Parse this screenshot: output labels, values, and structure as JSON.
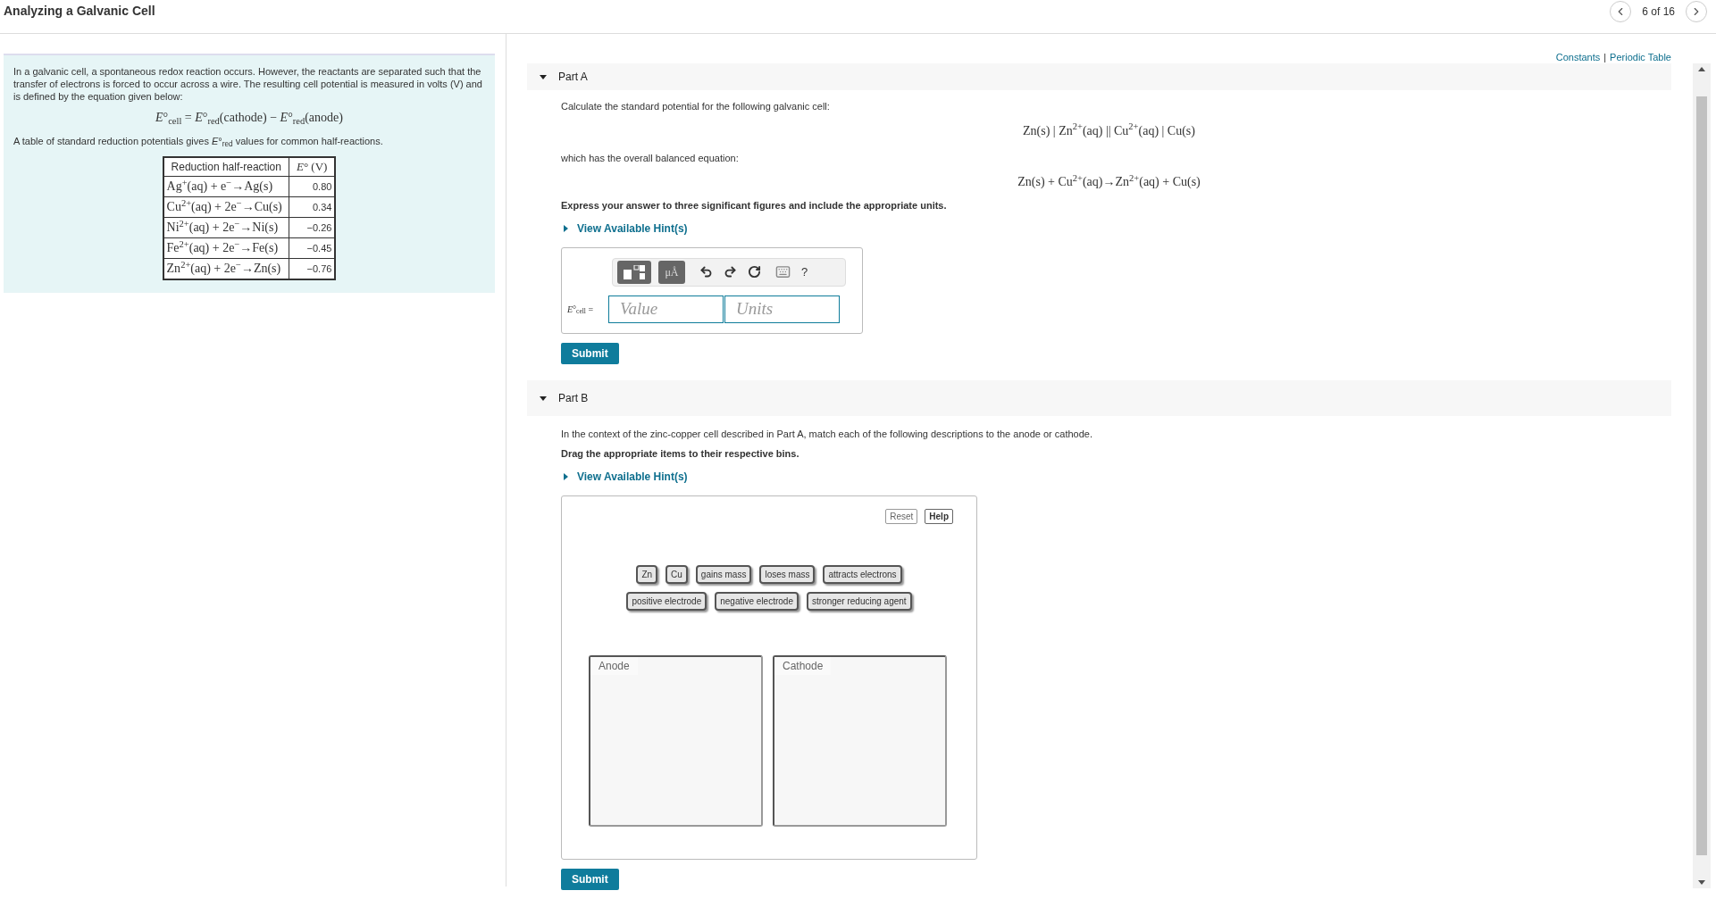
{
  "header": {
    "title": "Analyzing a Galvanic Cell",
    "pager": "6 of 16"
  },
  "intro": {
    "paragraph": "In a galvanic cell, a spontaneous redox reaction occurs. However, the reactants are separated such that the transfer of electrons is forced to occur across a wire. The resulting cell potential is measured in volts (V) and is defined by the equation given below:",
    "equation": "*E*°$_{cell}$ = *E*°$_{red}$(cathode) − *E*°$_{red}$(anode)",
    "table_intro": "A table of standard reduction potentials gives *E*°$_{red}$ values for common half-reactions.",
    "table": {
      "columns": [
        "Reduction half-reaction",
        "*E*° (V)"
      ],
      "rows": [
        [
          "Ag$^{+}$(aq) + e$^{−}$→Ag(s)",
          "0.80"
        ],
        [
          "Cu$^{2+}$(aq) + 2e$^{−}$→Cu(s)",
          "0.34"
        ],
        [
          "Ni$^{2+}$(aq) + 2e$^{−}$→Ni(s)",
          "−0.26"
        ],
        [
          "Fe$^{2+}$(aq) + 2e$^{−}$→Fe(s)",
          "−0.45"
        ],
        [
          "Zn$^{2+}$(aq) + 2e$^{−}$→Zn(s)",
          "−0.76"
        ]
      ]
    }
  },
  "links": [
    "Constants",
    "Periodic Table"
  ],
  "link_separator": "|",
  "parts": [
    {
      "kind": "answer",
      "title": "Part A",
      "expanded": true,
      "prompt": "Calculate the standard potential for the following galvanic cell:",
      "formula": "Zn(s) | Zn$^{2+}$(aq) || Cu$^{2+}$(aq) | Cu(s)",
      "prompt2": "which has the overall balanced equation:",
      "formula2": "Zn(s) + Cu$^{2+}$(aq)→Zn$^{2+}$(aq) + Cu(s)",
      "instruction": "Express your answer to three significant figures and include the appropriate units.",
      "hint": {
        "label": "View Available Hint(s)",
        "expanded": false
      },
      "toolbar": {
        "units_button": "μÅ",
        "help_button": "?"
      },
      "answer_label": "*E*°$_{cell}$ =",
      "fields": [
        {
          "placeholder": "Value"
        },
        {
          "placeholder": "Units"
        }
      ],
      "submit": "Submit"
    },
    {
      "kind": "sort",
      "title": "Part B",
      "expanded": true,
      "prompt": "In the context of the zinc-copper cell described in Part A, match each of the following descriptions to the anode or cathode.",
      "instruction": "Drag the appropriate items to their respective bins.",
      "hint": {
        "label": "View Available Hint(s)",
        "expanded": false
      },
      "reset": "Reset",
      "help": "Help",
      "item_rows": [
        [
          "Zn",
          "Cu",
          "gains mass",
          "loses mass",
          "attracts electrons"
        ],
        [
          "positive electrode",
          "negative electrode",
          "stronger reducing agent"
        ]
      ],
      "bins": [
        "Anode",
        "Cathode"
      ],
      "submit": "Submit"
    }
  ]
}
